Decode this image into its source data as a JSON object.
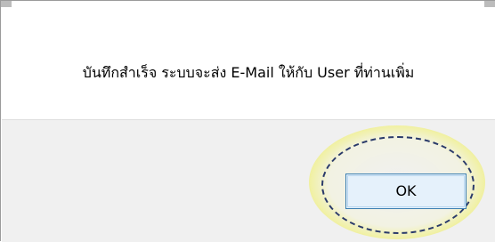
{
  "dialog": {
    "message": "บันทึกสำเร็จ ระบบจะส่ง E-Mail ให้กับ User ที่ท่านเพิ่ม",
    "ok_label": "OK"
  },
  "colors": {
    "footer_bg": "#f0f0f0",
    "button_border": "#3c7fb1",
    "button_bg": "#e5f1fb",
    "highlight": "#f0f03c"
  }
}
